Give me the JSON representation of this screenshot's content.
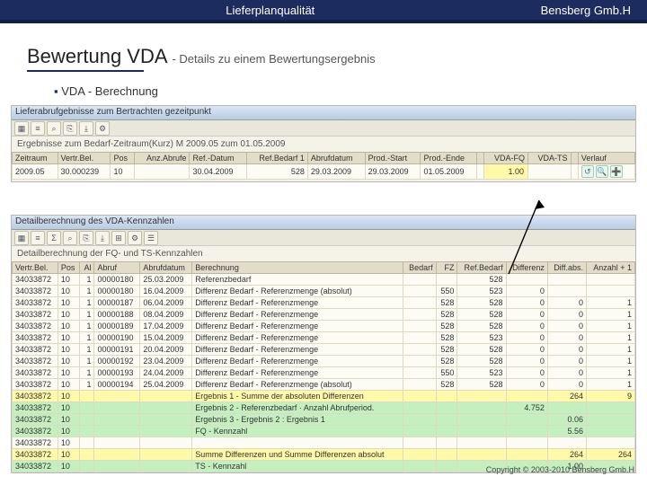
{
  "header": {
    "left": "Lieferplanqualität",
    "right": "Bensberg Gmb.H"
  },
  "title": {
    "main": "Bewertung VDA ",
    "sub": "- Details zu einem Bewertungsergebnis"
  },
  "bullet": "VDA - Berechnung",
  "win1": {
    "title": "Lieferabrufgebnisse zum Bertrachten gezeitpunkt",
    "caption": "Ergebnisse zum Bedarf-Zeitraum(Kurz) M 2009.05 zum 01.05.2009",
    "cols": [
      "Zeitraum",
      "Vertr.Bel.",
      "Pos",
      "Anz.Abrufe",
      "Ref.-Datum",
      "Ref.Bedarf 1",
      "Abrufdatum",
      "Prod.-Start",
      "Prod.-Ende",
      "",
      "VDA-FQ",
      "VDA-TS",
      "",
      "Verlauf"
    ],
    "row": [
      "2009.05",
      "30.000239",
      "10",
      "",
      "30.04.2009",
      "528",
      "29.03.2009",
      "29.03.2009",
      "01.05.2009",
      "",
      "1.00",
      "",
      "",
      ""
    ],
    "icons": [
      "↺",
      "🔍",
      "➕"
    ]
  },
  "win2": {
    "title": "Detailberechnung des VDA-Kennzahlen",
    "caption": "Detailberechnung der FQ- und TS-Kennzahlen",
    "cols": [
      "Vertr.Bel.",
      "Pos",
      "Al",
      "Abruf",
      "Abrufdatum",
      "Berechnung",
      "Bedarf",
      "FZ",
      "Ref.Bedarf",
      "Differenz",
      "Diff.abs.",
      "Anzahl + 1"
    ],
    "rows": [
      [
        "34033872",
        "10",
        "1",
        "00000180",
        "25.03.2009",
        "Referenzbedarf",
        "",
        "",
        "528",
        "",
        "",
        ""
      ],
      [
        "34033872",
        "10",
        "1",
        "00000180",
        "16.04.2009",
        "Differenz Bedarf - Referenzmenge (absolut)",
        "",
        "550",
        "523",
        "0",
        "",
        ""
      ],
      [
        "34033872",
        "10",
        "1",
        "00000187",
        "06.04.2009",
        "Differenz Bedarf - Referenzmenge",
        "",
        "528",
        "528",
        "0",
        "0",
        "1"
      ],
      [
        "34033872",
        "10",
        "1",
        "00000188",
        "08.04.2009",
        "Differenz Bedarf - Referenzmenge",
        "",
        "528",
        "528",
        "0",
        "0",
        "1"
      ],
      [
        "34033872",
        "10",
        "1",
        "00000189",
        "17.04.2009",
        "Differenz Bedarf - Referenzmenge",
        "",
        "528",
        "528",
        "0",
        "0",
        "1"
      ],
      [
        "34033872",
        "10",
        "1",
        "00000190",
        "15.04.2009",
        "Differenz Bedarf - Referenzmenge",
        "",
        "528",
        "523",
        "0",
        "0",
        "1"
      ],
      [
        "34033872",
        "10",
        "1",
        "00000191",
        "20.04.2009",
        "Differenz Bedarf - Referenzmenge",
        "",
        "528",
        "528",
        "0",
        "0",
        "1"
      ],
      [
        "34033872",
        "10",
        "1",
        "00000192",
        "23.04.2009",
        "Differenz Bedarf - Referenzmenge",
        "",
        "528",
        "528",
        "0",
        "0",
        "1"
      ],
      [
        "34033872",
        "10",
        "1",
        "00000193",
        "24.04.2009",
        "Differenz Bedarf - Referenzmenge",
        "",
        "550",
        "523",
        "0",
        "0",
        "1"
      ],
      [
        "34033872",
        "10",
        "1",
        "00000194",
        "25.04.2009",
        "Differenz Bedarf - Referenzmenge (absolut)",
        "",
        "528",
        "528",
        "0",
        "0",
        "1"
      ],
      [
        "34033872",
        "10",
        "",
        "",
        "",
        "Ergebnis 1 - Summe der absoluten Differenzen",
        "",
        "",
        "",
        "",
        "264",
        "9"
      ],
      [
        "34033872",
        "10",
        "",
        "",
        "",
        "Ergebnis 2 - Referenzbedarf · Anzahl Abrufperiod.",
        "",
        "",
        "",
        "4.752",
        "",
        ""
      ],
      [
        "34033872",
        "10",
        "",
        "",
        "",
        "Ergebnis 3 - Ergebnis 2 : Ergebnis 1",
        "",
        "",
        "",
        "",
        "0.06",
        ""
      ],
      [
        "34033872",
        "10",
        "",
        "",
        "",
        "FQ - Kennzahl",
        "",
        "",
        "",
        "",
        "5.56",
        ""
      ],
      [
        "34033872",
        "10",
        "",
        "",
        "",
        "",
        "",
        "",
        "",
        "",
        "",
        ""
      ],
      [
        "34033872",
        "10",
        "",
        "",
        "",
        "Summe Differenzen und Summe Differenzen absolut",
        "",
        "",
        "",
        "",
        "264",
        "264"
      ],
      [
        "34033872",
        "10",
        "",
        "",
        "",
        "TS - Kennzahl",
        "",
        "",
        "",
        "",
        "1.00",
        ""
      ]
    ],
    "hl": {
      "yellow": [
        10,
        15
      ],
      "green": [
        11,
        12,
        13,
        16
      ]
    }
  },
  "footer": "Copyright © 2003-2010 Bensberg Gmb.H"
}
